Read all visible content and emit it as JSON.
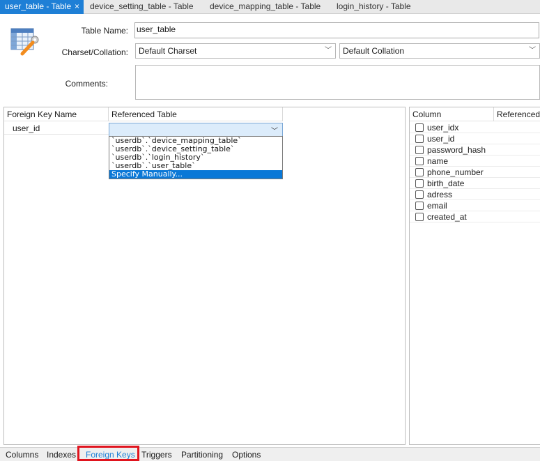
{
  "tabs": [
    {
      "label": "user_table - Table",
      "active": true
    },
    {
      "label": "device_setting_table - Table",
      "active": false
    },
    {
      "label": "device_mapping_table - Table",
      "active": false
    },
    {
      "label": "login_history - Table",
      "active": false
    }
  ],
  "close_glyph": "×",
  "form": {
    "table_name_label": "Table Name:",
    "table_name_value": "user_table",
    "charset_label": "Charset/Collation:",
    "charset_value": "Default Charset",
    "collation_value": "Default Collation",
    "comments_label": "Comments:"
  },
  "fk_panel": {
    "headers": [
      "Foreign Key Name",
      "Referenced Table"
    ],
    "rows": [
      {
        "name": "user_id",
        "referenced_table": ""
      }
    ],
    "dropdown_options": [
      "`userdb`.`device_mapping_table`",
      "`userdb`.`device_setting_table`",
      "`userdb`.`login_history`",
      "`userdb`.`user_table`",
      "Specify Manually..."
    ],
    "selected_option_index": 4
  },
  "columns_panel": {
    "headers": [
      "Column",
      "Referenced C"
    ],
    "columns": [
      "user_idx",
      "user_id",
      "password_hash",
      "name",
      "phone_number",
      "birth_date",
      "adress",
      "email",
      "created_at"
    ]
  },
  "bottom_tabs": [
    {
      "label": "Columns",
      "active": false
    },
    {
      "label": "Indexes",
      "active": false
    },
    {
      "label": "Foreign Keys",
      "active": true
    },
    {
      "label": "Triggers",
      "active": false
    },
    {
      "label": "Partitioning",
      "active": false
    },
    {
      "label": "Options",
      "active": false
    }
  ],
  "colors": {
    "accent": "#1e7fd6",
    "selection": "#0a78d7",
    "highlight_border": "#e0141e"
  },
  "icons": {
    "table_editor": "table-wrench-icon",
    "chevron": "chevron-down-icon",
    "close": "close-icon"
  }
}
